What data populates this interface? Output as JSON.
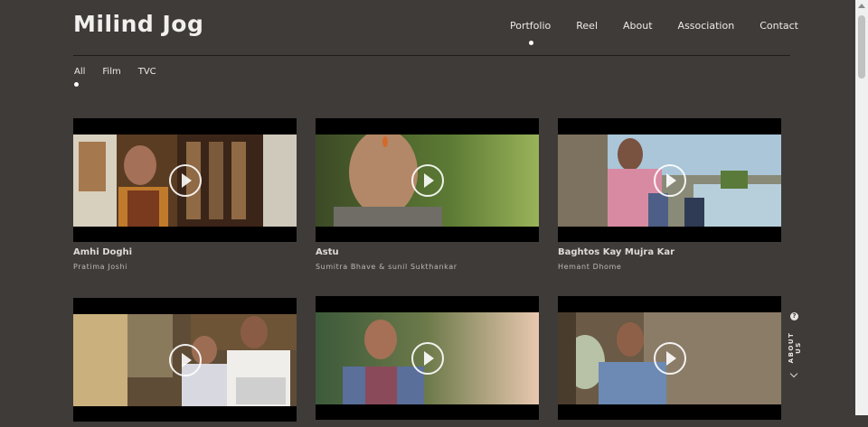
{
  "site": {
    "logo": "Milind Jog"
  },
  "nav": {
    "active": "Portfolio",
    "items": [
      {
        "label": "Portfolio"
      },
      {
        "label": "Reel"
      },
      {
        "label": "About"
      },
      {
        "label": "Association"
      },
      {
        "label": "Contact"
      }
    ]
  },
  "filters": {
    "active": "All",
    "items": [
      {
        "label": "All"
      },
      {
        "label": "Film"
      },
      {
        "label": "TVC"
      }
    ]
  },
  "films": [
    {
      "title": "Amhi Doghi",
      "director": "Pratima Joshi"
    },
    {
      "title": "Astu",
      "director": "Sumitra Bhave & sunil Sukthankar"
    },
    {
      "title": "Baghtos Kay Mujra Kar",
      "director": "Hemant Dhome"
    },
    {
      "title": "",
      "director": ""
    },
    {
      "title": "",
      "director": ""
    },
    {
      "title": "",
      "director": ""
    }
  ],
  "about_tab": {
    "label": "ABOUT US",
    "icon": "?"
  },
  "colors": {
    "background": "#3f3b39",
    "text": "#ecebea",
    "accent_dot": "#ffffff"
  }
}
